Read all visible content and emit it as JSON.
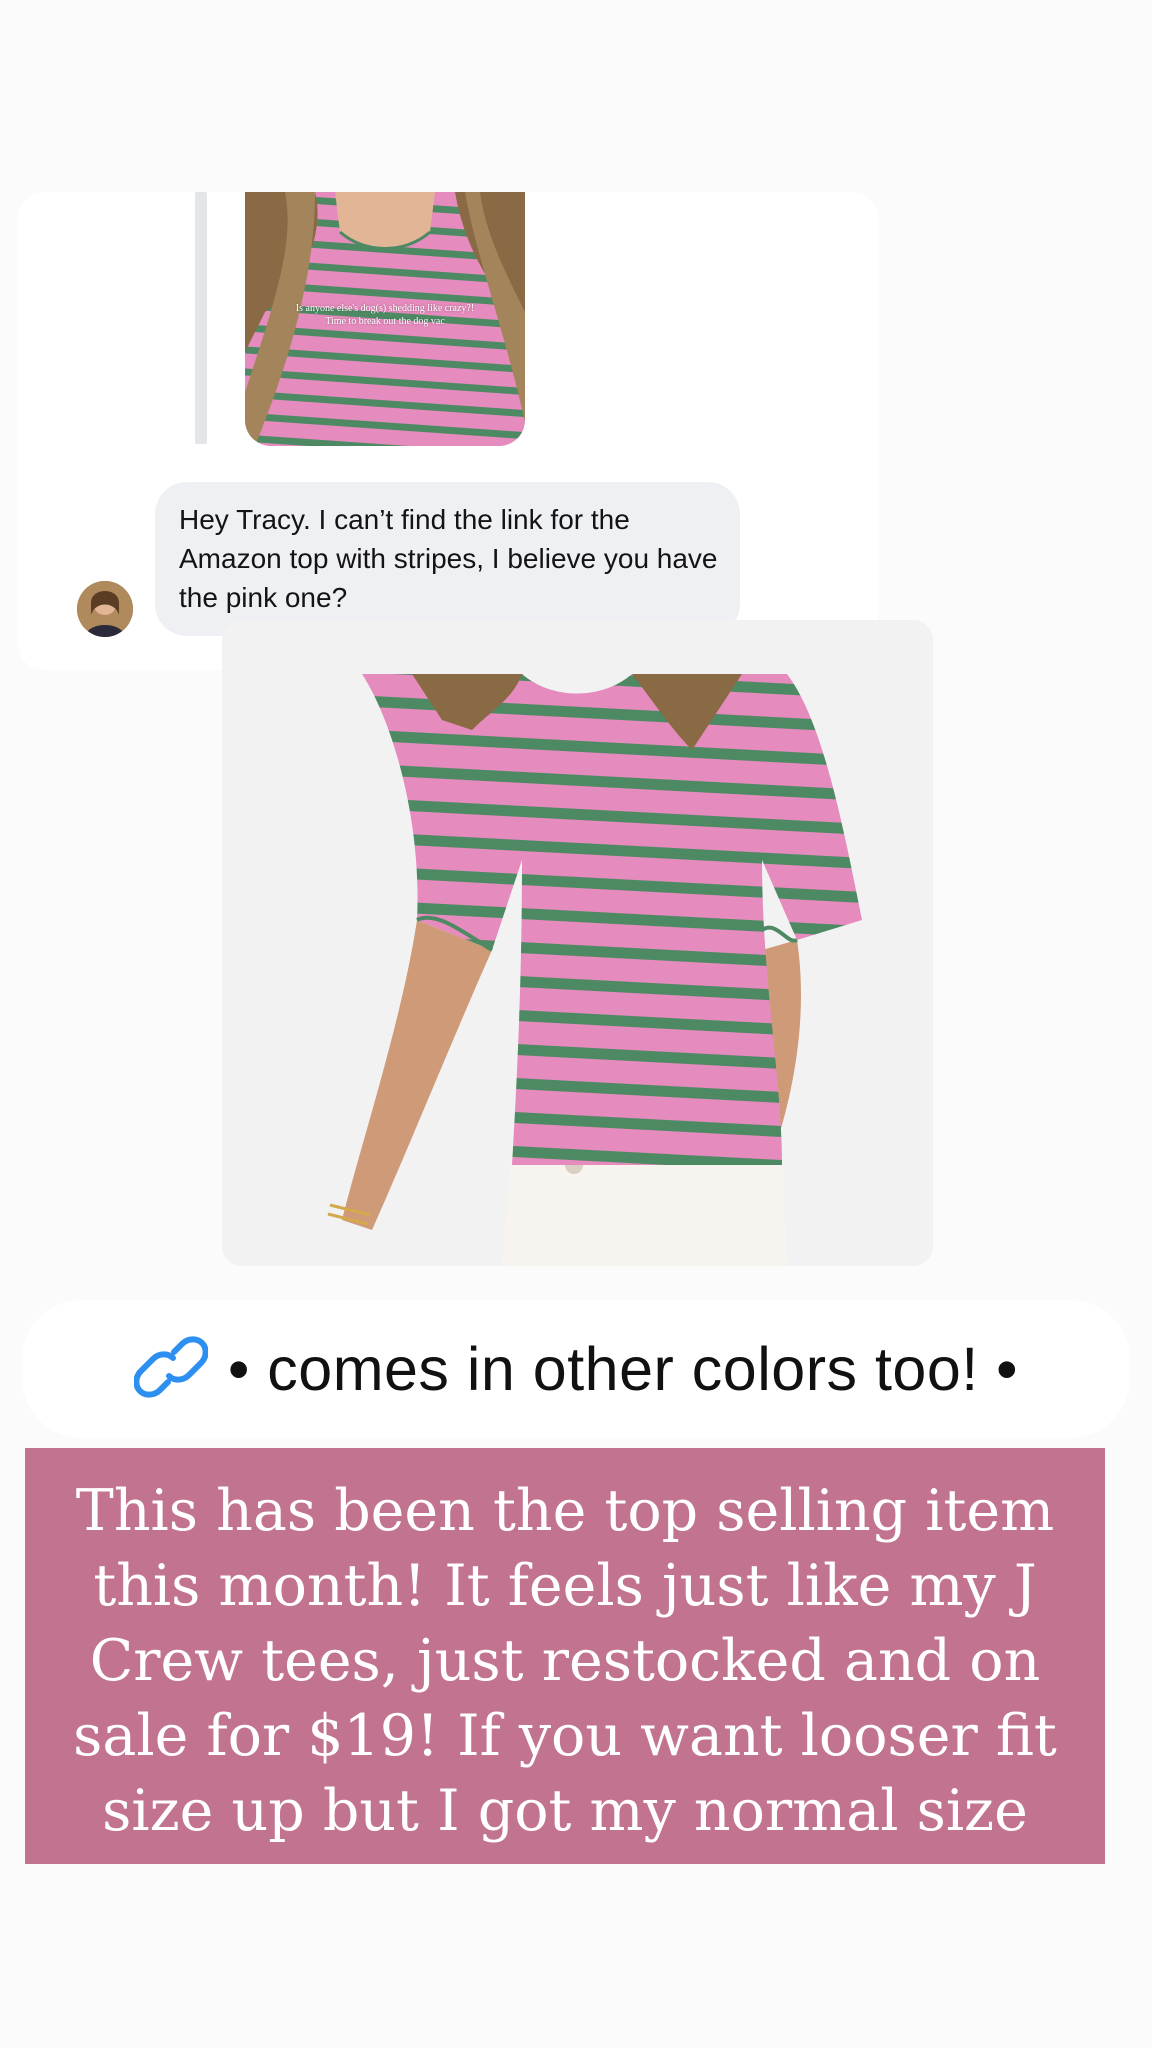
{
  "shared_story": {
    "overlay_line1": "Is anyone else's dog(s) shedding like crazy?!",
    "overlay_line2": "Time to break out the dog vac"
  },
  "message": {
    "text": "Hey Tracy. I can’t find the link for the Amazon top with stripes, I believe you have the pink one?"
  },
  "link_sticker": {
    "icon": "link-icon",
    "label": "• comes in other colors too! •"
  },
  "caption": {
    "text": "This has been the top selling item this month! It feels just like my J Crew tees, just restocked and on sale for $19! If you want looser fit size up but I got my normal size"
  },
  "colors": {
    "caption_background": "#c27390",
    "stripe_pink": "#e58bbd",
    "stripe_green": "#4d8a64",
    "link_icon": "#2d8ff0"
  }
}
